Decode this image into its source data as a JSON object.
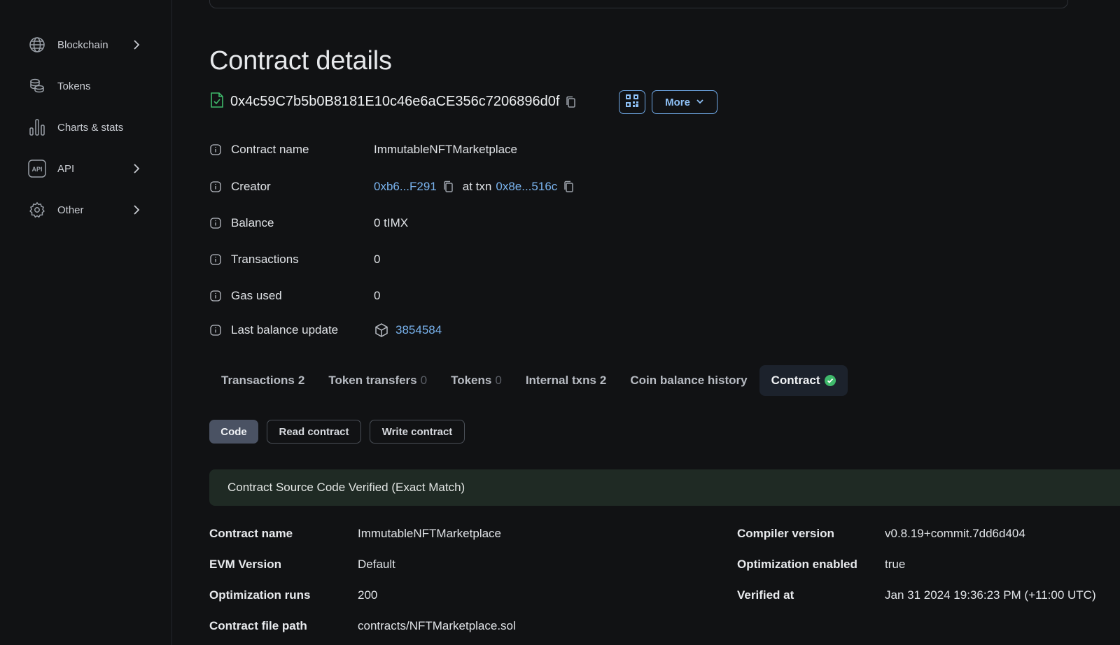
{
  "sidebar": {
    "items": [
      {
        "label": "Blockchain",
        "icon": "globe-icon",
        "has_chevron": true
      },
      {
        "label": "Tokens",
        "icon": "coins-icon",
        "has_chevron": false
      },
      {
        "label": "Charts & stats",
        "icon": "bar-chart-icon",
        "has_chevron": false
      },
      {
        "label": "API",
        "icon": "api-icon",
        "has_chevron": true
      },
      {
        "label": "Other",
        "icon": "gear-icon",
        "has_chevron": true
      }
    ]
  },
  "page": {
    "title": "Contract details",
    "address": "0x4c59C7b5b0B8181E10c46e6aCE356c7206896d0f",
    "more_label": "More"
  },
  "details": {
    "contract_name": {
      "label": "Contract name",
      "value": "ImmutableNFTMarketplace"
    },
    "creator": {
      "label": "Creator",
      "address": "0xb6...F291",
      "at_txn": "at txn",
      "txn": "0x8e...516c"
    },
    "balance": {
      "label": "Balance",
      "value": "0 tIMX"
    },
    "transactions": {
      "label": "Transactions",
      "value": "0"
    },
    "gas_used": {
      "label": "Gas used",
      "value": "0"
    },
    "last_balance_update": {
      "label": "Last balance update",
      "value": "3854584"
    }
  },
  "tabs": [
    {
      "label": "Transactions",
      "count": "2",
      "count_style": "inline"
    },
    {
      "label": "Token transfers",
      "count": "0",
      "count_style": "muted"
    },
    {
      "label": "Tokens",
      "count": "0",
      "count_style": "muted"
    },
    {
      "label": "Internal txns",
      "count": "2",
      "count_style": "inline"
    },
    {
      "label": "Coin balance history",
      "count": "",
      "count_style": "none"
    },
    {
      "label": "Contract",
      "count": "",
      "count_style": "verified",
      "active": true
    }
  ],
  "subtabs": {
    "code": "Code",
    "read": "Read contract",
    "write": "Write contract"
  },
  "verified_banner": "Contract Source Code Verified (Exact Match)",
  "contract_meta": {
    "left": [
      {
        "label": "Contract name",
        "value": "ImmutableNFTMarketplace"
      },
      {
        "label": "EVM Version",
        "value": "Default"
      },
      {
        "label": "Optimization runs",
        "value": "200"
      },
      {
        "label": "Contract file path",
        "value": "contracts/NFTMarketplace.sol"
      }
    ],
    "right": [
      {
        "label": "Compiler version",
        "value": "v0.8.19+commit.7dd6d404"
      },
      {
        "label": "Optimization enabled",
        "value": "true"
      },
      {
        "label": "Verified at",
        "value": "Jan 31 2024 19:36:23 PM (+11:00 UTC)"
      }
    ]
  },
  "colors": {
    "accent": "#79b3ee",
    "success": "#3fb96b",
    "background": "#111214"
  }
}
